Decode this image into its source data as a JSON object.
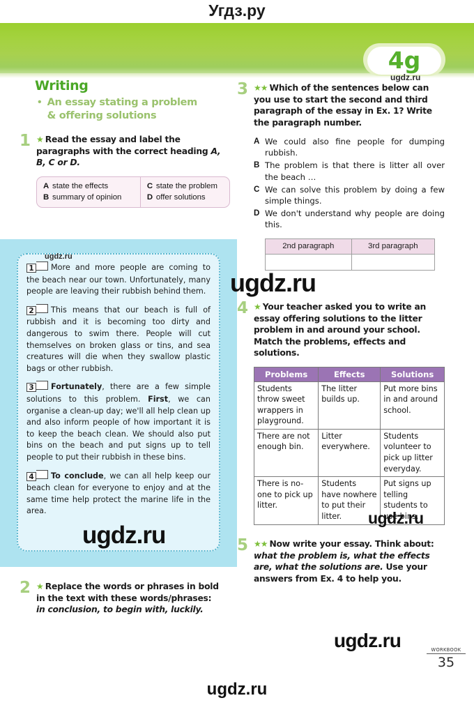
{
  "watermarks": {
    "top": "Угдз.ру",
    "badge": "ugdz.ru",
    "essay_small": "ugdz.ru",
    "essay_large": "ugdz.ru",
    "right_large": "ugdz.ru",
    "right_small": "ugdz.ru",
    "footer": "ugdz.ru",
    "bottom": "ugdz.ru"
  },
  "header": {
    "unit_badge": "4g"
  },
  "writing_section": {
    "title": "Writing",
    "subtitle_line1": "An essay stating a problem",
    "subtitle_line2": "& offering solutions"
  },
  "exercise1": {
    "number": "1",
    "stars": "★",
    "instruction": "Read the essay and label the paragraphs with the correct heading ",
    "instruction_italic": "A, B, C or D.",
    "headings": [
      {
        "letter": "A",
        "text": "state the effects"
      },
      {
        "letter": "B",
        "text": "summary of opinion"
      },
      {
        "letter": "C",
        "text": "state the problem"
      },
      {
        "letter": "D",
        "text": "offer solutions"
      }
    ]
  },
  "essay": {
    "paragraphs": [
      {
        "number": "1",
        "answer": "",
        "text_before_bold": "",
        "bold": "",
        "text": "More and more people are coming to the beach near our town. Unfortunately, many people are leaving their rubbish behind them."
      },
      {
        "number": "2",
        "answer": "",
        "text": "This means that our beach is full of rubbish and it is becoming too dirty and dangerous to swim there. People will cut themselves on broken glass or tins, and sea creatures will die when they swallow plastic bags or other rubbish."
      },
      {
        "number": "3",
        "answer": "",
        "bold1": "Fortunately",
        "text1": ", there are a few simple solutions to this problem. ",
        "bold2": "First",
        "text2": ", we can organise a clean-up day; we'll all help clean up and also inform people of how important it is to keep the beach clean. We should also put bins on the beach and put signs up to tell people to put their rubbish in these bins."
      },
      {
        "number": "4",
        "answer": "",
        "bold1": "To conclude",
        "text1": ", we can all help keep our beach clean for everyone to enjoy and at the same time help protect the marine life in the area."
      }
    ]
  },
  "exercise2": {
    "number": "2",
    "stars": "★",
    "instruction": "Replace the words or phrases in bold in the text with these words/phrases:",
    "words": "in conclusion, to begin with, luckily."
  },
  "exercise3": {
    "number": "3",
    "stars": "★★",
    "instruction": "Which of the sentences below can you use to start the second and third paragraph of the essay in Ex. 1? Write the paragraph number.",
    "options": [
      {
        "letter": "A",
        "text": "We could also fine people for dumping rubbish."
      },
      {
        "letter": "B",
        "text": "The problem is that there is litter all over the beach …"
      },
      {
        "letter": "C",
        "text": "We can solve this problem by doing a few simple things."
      },
      {
        "letter": "D",
        "text": "We don't understand why people are doing this."
      }
    ],
    "answer_table": {
      "headers": [
        "2nd paragraph",
        "3rd paragraph"
      ],
      "rows": [
        [
          "",
          ""
        ]
      ]
    }
  },
  "exercise4": {
    "number": "4",
    "stars": "★",
    "instruction": "Your teacher asked you to write an essay offering solutions to the litter problem in and around your school. Match the problems, effects and solutions.",
    "table": {
      "headers": [
        "Problems",
        "Effects",
        "Solutions"
      ],
      "rows": [
        [
          "Students throw sweet wrappers in playground.",
          "The litter builds up.",
          "Put more bins in and around school."
        ],
        [
          "There are not enough bin.",
          "Litter everywhere.",
          "Students volunteer to pick up litter everyday."
        ],
        [
          "There is no-one to pick up litter.",
          "Students have nowhere to put their litter.",
          "Put signs up telling students to use bins."
        ]
      ]
    }
  },
  "exercise5": {
    "number": "5",
    "stars": "★★",
    "part1": "Now write your essay. Think about",
    "part2": ": ",
    "italic": "what the problem is, what the effects are, what the solutions are.",
    "part3": " Use your answers from Ex. 4 to help you."
  },
  "footer": {
    "label": "WORKBOOK",
    "page": "35"
  },
  "colors": {
    "header_green": "#a4d23e",
    "title_green": "#4aa726",
    "subtitle_green": "#9ac26d",
    "number_green": "#a7cf7f",
    "star_green": "#7dbf3a",
    "essay_panel_blue": "#aee3f0",
    "essay_inner_blue": "#e3f5fb",
    "pink_box": "#fbf1f6",
    "table_header_purple": "#9b74b4",
    "para_table_header_pink": "#f0dbe8"
  }
}
